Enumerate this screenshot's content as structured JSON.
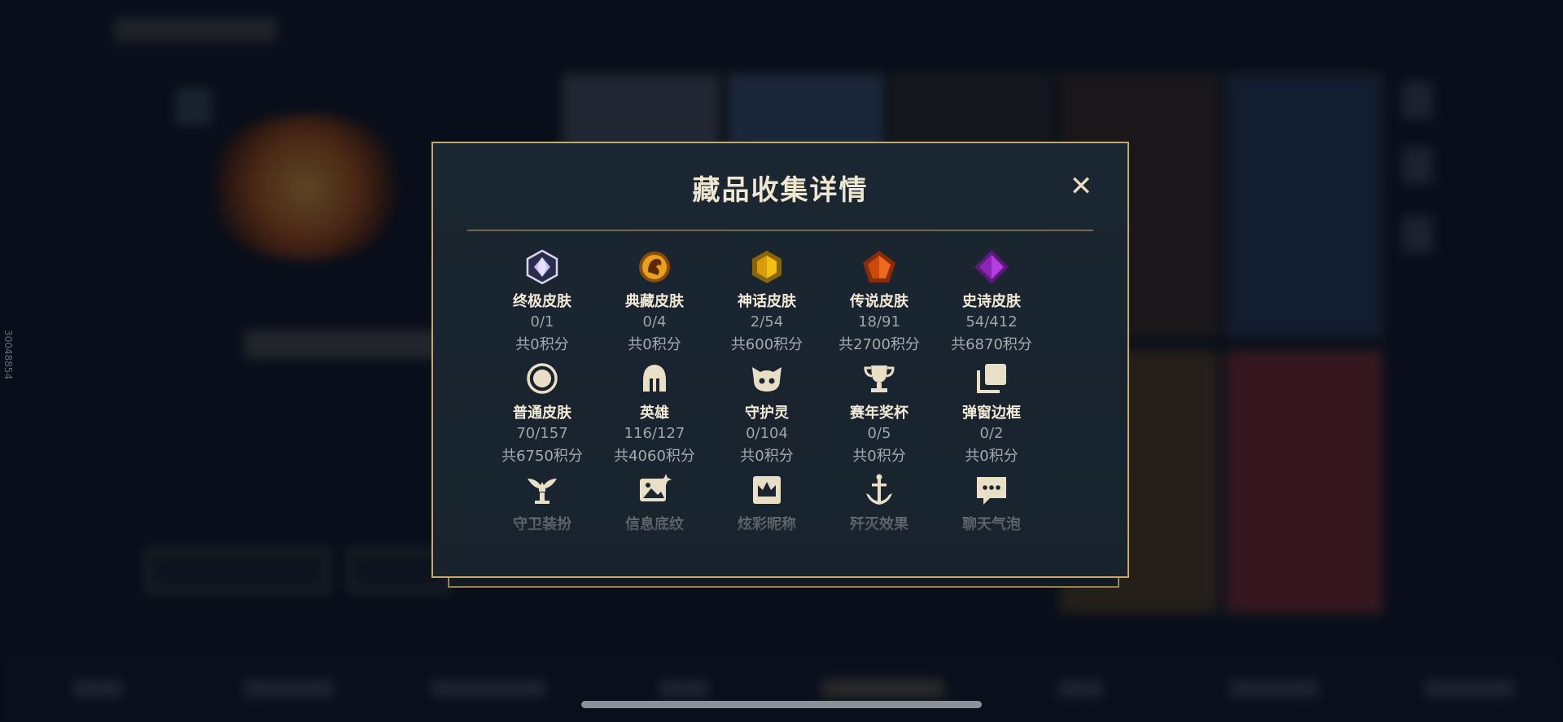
{
  "modal": {
    "title": "藏品收集详情",
    "close_label": "✕"
  },
  "side_id": "30048854",
  "categories": [
    {
      "label": "终极皮肤",
      "count": "0/1",
      "points": "共0积分",
      "icon": "ultimate-gem-icon",
      "color": "#c9b8ff"
    },
    {
      "label": "典藏皮肤",
      "count": "0/4",
      "points": "共0积分",
      "icon": "dragon-emblem-icon",
      "color": "#e8a21a"
    },
    {
      "label": "神话皮肤",
      "count": "2/54",
      "points": "共600积分",
      "icon": "mythic-gem-icon",
      "color": "#f2c015"
    },
    {
      "label": "传说皮肤",
      "count": "18/91",
      "points": "共2700积分",
      "icon": "legendary-gem-icon",
      "color": "#ef6a1d"
    },
    {
      "label": "史诗皮肤",
      "count": "54/412",
      "points": "共6870积分",
      "icon": "epic-gem-icon",
      "color": "#b23de0"
    },
    {
      "label": "普通皮肤",
      "count": "70/157",
      "points": "共6750积分",
      "icon": "circle-badge-icon",
      "color": "#e9dfc6"
    },
    {
      "label": "英雄",
      "count": "116/127",
      "points": "共4060积分",
      "icon": "helmet-icon",
      "color": "#e9dfc6"
    },
    {
      "label": "守护灵",
      "count": "0/104",
      "points": "共0积分",
      "icon": "guardian-spirit-icon",
      "color": "#e9dfc6"
    },
    {
      "label": "赛年奖杯",
      "count": "0/5",
      "points": "共0积分",
      "icon": "trophy-icon",
      "color": "#e9dfc6"
    },
    {
      "label": "弹窗边框",
      "count": "0/2",
      "points": "共0积分",
      "icon": "stacked-frames-icon",
      "color": "#e9dfc6"
    },
    {
      "label": "守卫装扮",
      "icon": "ward-icon",
      "color": "#e9dfc6"
    },
    {
      "label": "信息底纹",
      "icon": "image-sparkle-icon",
      "color": "#e9dfc6"
    },
    {
      "label": "炫彩昵称",
      "icon": "crown-card-icon",
      "color": "#e9dfc6"
    },
    {
      "label": "歼灭效果",
      "icon": "sword-icon",
      "color": "#e9dfc6"
    },
    {
      "label": "聊天气泡",
      "icon": "chat-bubble-icon",
      "color": "#e9dfc6"
    }
  ]
}
